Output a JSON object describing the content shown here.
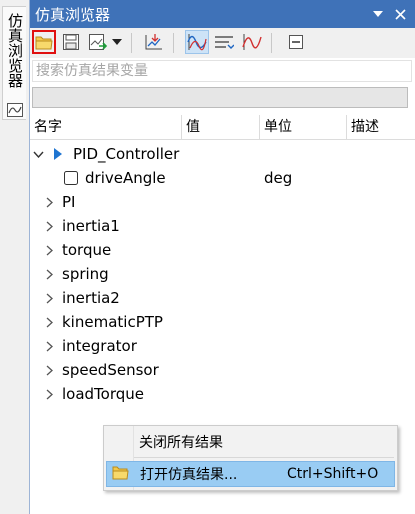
{
  "sidetab": {
    "label": "仿真浏览器",
    "icon": "plot-icon"
  },
  "panel": {
    "title": "仿真浏览器",
    "title_controls": [
      "dropdown-arrow-icon",
      "close-icon"
    ]
  },
  "toolbar": {
    "buttons": [
      "open-folder-icon",
      "save-icon",
      "export-icon",
      "export-dropdown-icon",
      "import-data-icon",
      "plot-variables-icon",
      "parameters-icon",
      "plot-parametric-icon",
      "clear-icon"
    ]
  },
  "search": {
    "placeholder": "搜索仿真结果变量"
  },
  "progress": {
    "value": 0
  },
  "columns": {
    "name": "名字",
    "value": "值",
    "unit": "单位",
    "description": "描述"
  },
  "tree": {
    "root": {
      "label": "PID_Controller",
      "expanded": true
    },
    "child": {
      "label": "driveAngle",
      "unit": "deg",
      "checked": false
    },
    "items": [
      "PI",
      "inertia1",
      "torque",
      "spring",
      "inertia2",
      "kinematicPTP",
      "integrator",
      "speedSensor",
      "loadTorque"
    ]
  },
  "context_menu": {
    "close_all": "关闭所有结果",
    "open_result": "打开仿真结果...",
    "open_shortcut": "Ctrl+Shift+O"
  },
  "colors": {
    "titlebar": "#3f72b8",
    "highlight": "#99ccf3",
    "accent": "#0078d7"
  }
}
